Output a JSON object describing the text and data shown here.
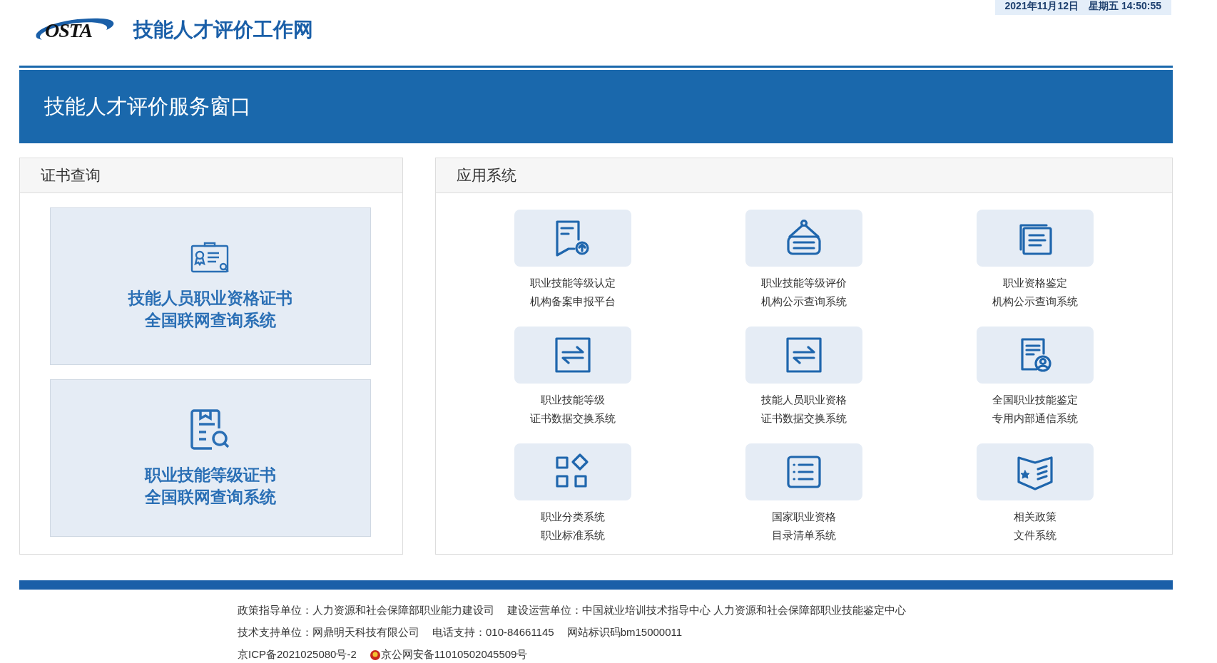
{
  "header": {
    "logo_text": "OSTA",
    "site_title": "技能人才评价工作网",
    "datetime": "2021年11月12日　星期五 14:50:55"
  },
  "banner": {
    "title": "技能人才评价服务窗口"
  },
  "certificate_panel": {
    "title": "证书查询",
    "cards": [
      {
        "lines": [
          "技能人员职业资格证书",
          "全国联网查询系统"
        ]
      },
      {
        "lines": [
          "职业技能等级证书",
          "全国联网查询系统"
        ]
      }
    ]
  },
  "apps_panel": {
    "title": "应用系统",
    "items": [
      {
        "lines": [
          "职业技能等级认定",
          "机构备案申报平台"
        ]
      },
      {
        "lines": [
          "职业技能等级评价",
          "机构公示查询系统"
        ]
      },
      {
        "lines": [
          "职业资格鉴定",
          "机构公示查询系统"
        ]
      },
      {
        "lines": [
          "职业技能等级",
          "证书数据交换系统"
        ]
      },
      {
        "lines": [
          "技能人员职业资格",
          "证书数据交换系统"
        ]
      },
      {
        "lines": [
          "全国职业技能鉴定",
          "专用内部通信系统"
        ]
      },
      {
        "lines": [
          "职业分类系统",
          "职业标准系统"
        ]
      },
      {
        "lines": [
          "国家职业资格",
          "目录清单系统"
        ]
      },
      {
        "lines": [
          "相关政策",
          "文件系统"
        ]
      }
    ]
  },
  "footer": {
    "lines": [
      [
        "政策指导单位：人力资源和社会保障部职业能力建设司",
        "建设运营单位：中国就业培训技术指导中心  人力资源和社会保障部职业技能鉴定中心"
      ],
      [
        "技术支持单位：网鼎明天科技有限公司",
        "电话支持：010-84661145",
        "网站标识码bm15000011"
      ],
      [
        "京ICP备2021025080号-2",
        "京公网安备11010502045509号"
      ]
    ]
  }
}
